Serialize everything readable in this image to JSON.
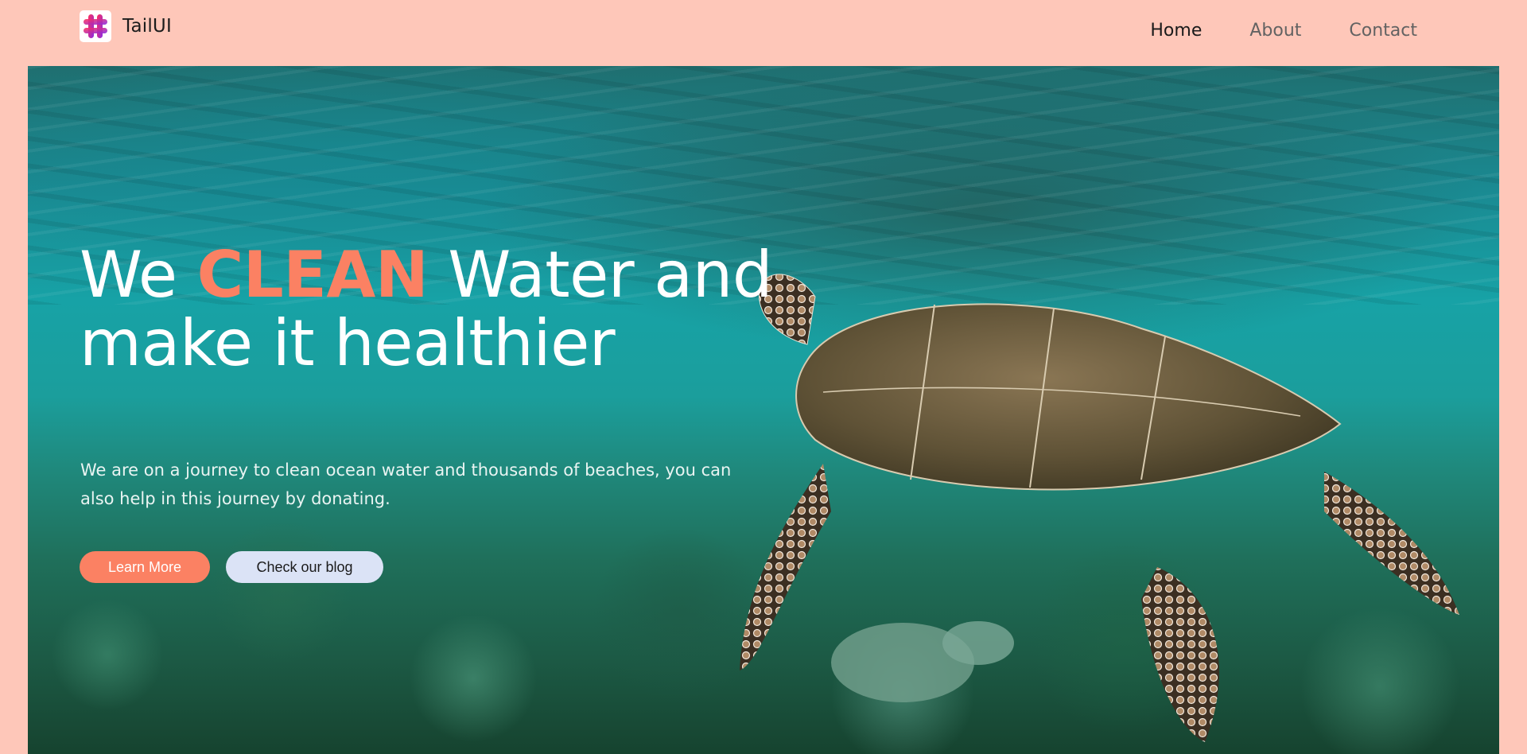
{
  "header": {
    "brand_name": "TailUI",
    "nav": [
      {
        "label": "Home",
        "active": true
      },
      {
        "label": "About",
        "active": false
      },
      {
        "label": "Contact",
        "active": false
      }
    ]
  },
  "hero": {
    "headline_pre": "We ",
    "headline_accent": "CLEAN",
    "headline_post": " Water and make it healthier",
    "subtext": "We are on a journey to clean ocean water and thousands of beaches, you can also help in this journey by donating.",
    "primary_button": "Learn More",
    "secondary_button": "Check our blog",
    "background_image": "underwater-sea-turtle-photo"
  },
  "colors": {
    "page_background": "#fec7b9",
    "accent": "#fb8163",
    "secondary_button": "#dbe3f6",
    "text_light": "#ffffff"
  },
  "icons": {
    "logo": "hash-grid-logo-icon"
  }
}
